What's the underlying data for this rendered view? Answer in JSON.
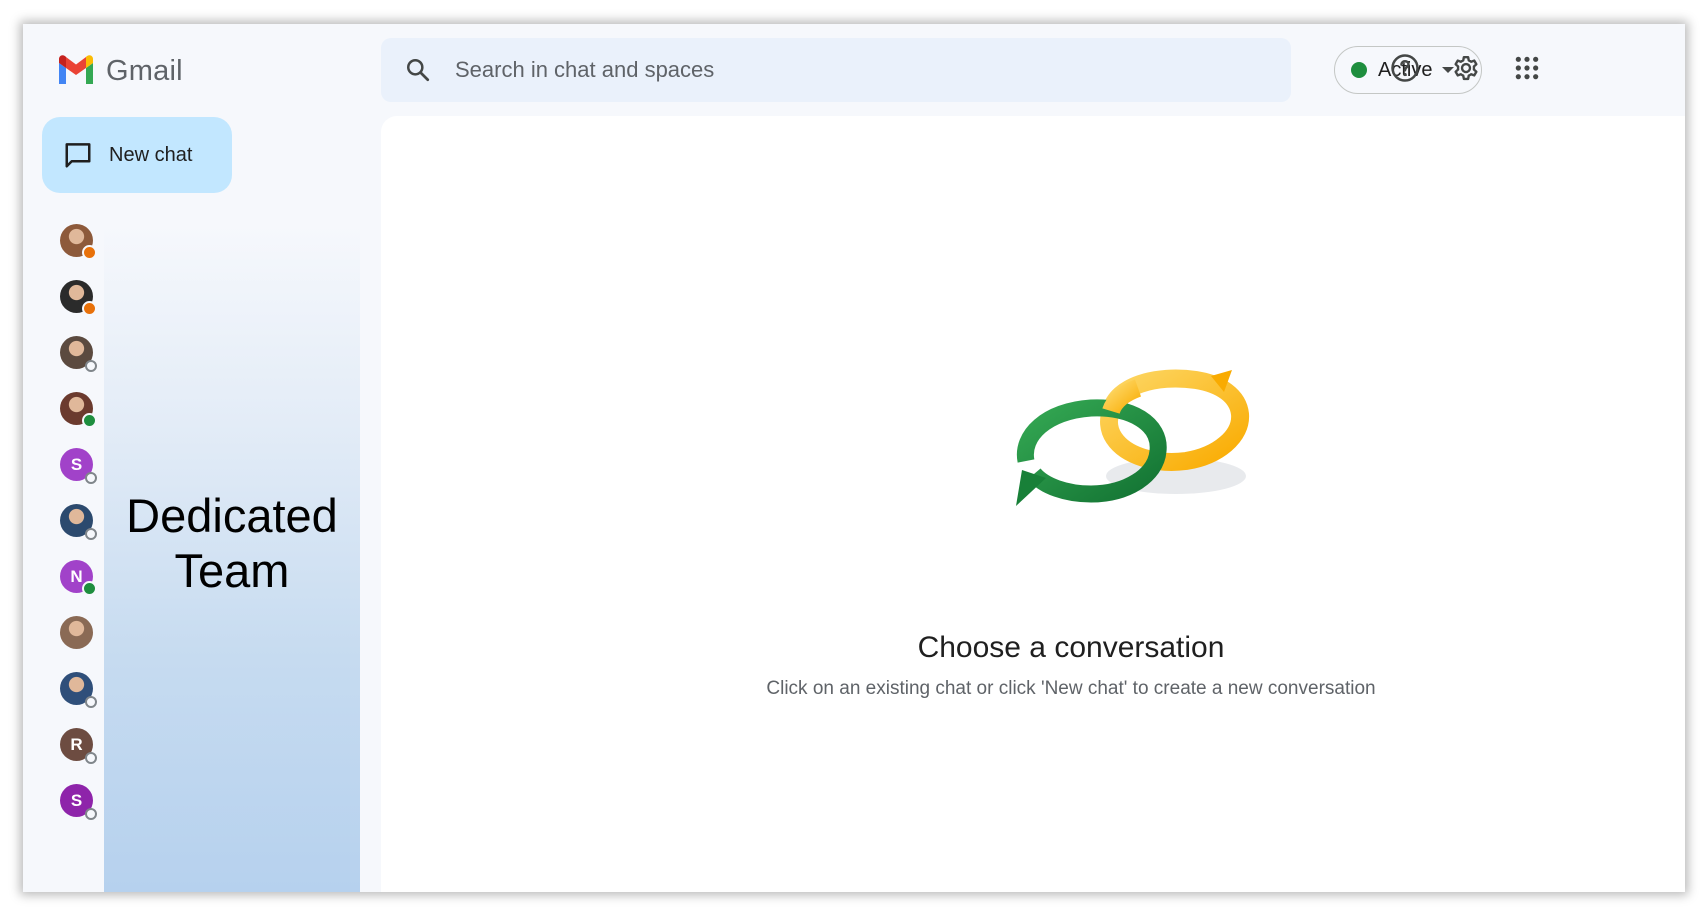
{
  "app": {
    "name": "Gmail",
    "icons": {
      "logo": "gmail-m-logo",
      "search": "search-icon",
      "help": "help-icon",
      "settings": "gear-icon",
      "apps": "apps-grid-icon",
      "new_chat": "chat-bubble-icon"
    }
  },
  "header": {
    "search": {
      "placeholder": "Search in chat and spaces"
    },
    "status": {
      "label": "Active",
      "color": "#1e8e3e"
    }
  },
  "sidebar": {
    "new_chat_label": "New chat",
    "team_label": "Dedicated\nTeam",
    "contacts": [
      {
        "initial": "",
        "type": "photo",
        "color": "#8d5a3b",
        "presence": "away"
      },
      {
        "initial": "",
        "type": "photo",
        "color": "#2b2b2b",
        "presence": "away"
      },
      {
        "initial": "",
        "type": "photo",
        "color": "#5b4a3f",
        "presence": "offline"
      },
      {
        "initial": "",
        "type": "photo",
        "color": "#6b3a2e",
        "presence": "active"
      },
      {
        "initial": "S",
        "type": "letter",
        "color": "#a142c9",
        "presence": "offline"
      },
      {
        "initial": "",
        "type": "photo",
        "color": "#2c4a6e",
        "presence": "offline"
      },
      {
        "initial": "N",
        "type": "letter",
        "color": "#a142c9",
        "presence": "active"
      },
      {
        "initial": "",
        "type": "photo",
        "color": "#8a6a55",
        "presence": "none"
      },
      {
        "initial": "",
        "type": "photo",
        "color": "#2f4f7a",
        "presence": "offline"
      },
      {
        "initial": "R",
        "type": "letter",
        "color": "#6d4c41",
        "presence": "offline"
      },
      {
        "initial": "S",
        "type": "letter",
        "color": "#8e24aa",
        "presence": "offline"
      }
    ]
  },
  "main": {
    "empty_state": {
      "title": "Choose a conversation",
      "subtitle": "Click on an existing chat or click 'New chat' to create a new conversation",
      "illustration": "chat-bubbles-illustration"
    }
  }
}
